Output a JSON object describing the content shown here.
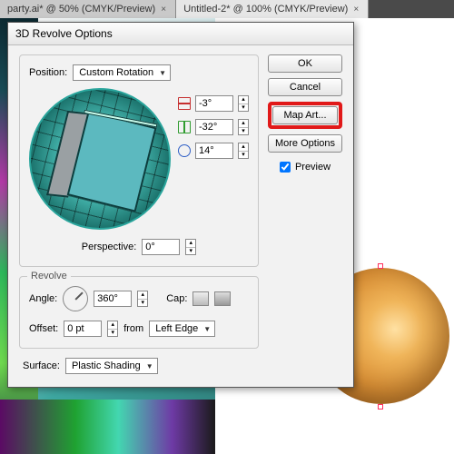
{
  "tabs": {
    "t1": "party.ai* @ 50% (CMYK/Preview)",
    "t2": "Untitled-2* @ 100% (CMYK/Preview)"
  },
  "dialog": {
    "title": "3D Revolve Options",
    "position": {
      "label": "Position:",
      "value": "Custom Rotation"
    },
    "axes": {
      "x": "-3°",
      "y": "-32°",
      "z": "14°"
    },
    "perspective": {
      "label": "Perspective:",
      "value": "0°"
    },
    "revolve": {
      "legend": "Revolve",
      "angle_label": "Angle:",
      "angle_value": "360°",
      "cap_label": "Cap:",
      "offset_label": "Offset:",
      "offset_value": "0 pt",
      "from_label": "from",
      "from_value": "Left Edge"
    },
    "surface": {
      "label": "Surface:",
      "value": "Plastic Shading"
    },
    "buttons": {
      "ok": "OK",
      "cancel": "Cancel",
      "map_art": "Map Art...",
      "more_options": "More Options"
    },
    "preview_label": "Preview"
  }
}
